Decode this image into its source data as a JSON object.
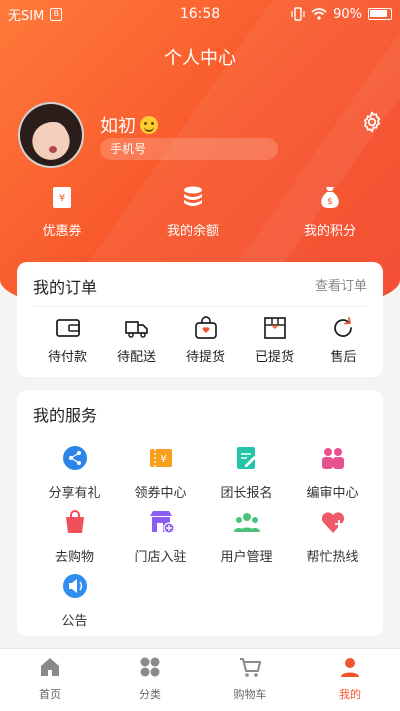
{
  "status_bar": {
    "carrier": "无SIM",
    "sim_icon_label": "B",
    "time": "16:58",
    "battery": "90%"
  },
  "header": {
    "title": "个人中心"
  },
  "profile": {
    "name": "如初",
    "phone_label": "手机号"
  },
  "hero_links": [
    {
      "label": "优惠券",
      "icon": "coupon-icon"
    },
    {
      "label": "我的余额",
      "icon": "coins-icon"
    },
    {
      "label": "我的积分",
      "icon": "money-bag-icon"
    }
  ],
  "orders": {
    "title": "我的订单",
    "view_all": "查看订单",
    "items": [
      {
        "label": "待付款",
        "icon": "wallet-icon"
      },
      {
        "label": "待配送",
        "icon": "delivery-truck-icon"
      },
      {
        "label": "待提货",
        "icon": "bag-icon"
      },
      {
        "label": "已提货",
        "icon": "box-icon"
      },
      {
        "label": "售后",
        "icon": "return-icon"
      }
    ]
  },
  "services": {
    "title": "我的服务",
    "items": [
      {
        "label": "分享有礼",
        "icon": "share-icon",
        "color": "#2b86e8"
      },
      {
        "label": "领券中心",
        "icon": "coupon-center-icon",
        "color": "#f6a01e"
      },
      {
        "label": "团长报名",
        "icon": "edit-form-icon",
        "color": "#23c4a8"
      },
      {
        "label": "编审中心",
        "icon": "users-icon",
        "color": "#e8518f"
      },
      {
        "label": "去购物",
        "icon": "shopping-bag-icon",
        "color": "#f0505a"
      },
      {
        "label": "门店入驻",
        "icon": "store-icon",
        "color": "#8b5cf6"
      },
      {
        "label": "用户管理",
        "icon": "group-icon",
        "color": "#4cc17a"
      },
      {
        "label": "帮忙热线",
        "icon": "heart-plus-icon",
        "color": "#f05a68"
      },
      {
        "label": "公告",
        "icon": "speaker-icon",
        "color": "#2f8ef0"
      }
    ]
  },
  "tabbar": {
    "items": [
      {
        "label": "首页",
        "icon": "home-icon"
      },
      {
        "label": "分类",
        "icon": "category-icon"
      },
      {
        "label": "购物车",
        "icon": "cart-icon"
      },
      {
        "label": "我的",
        "icon": "profile-icon",
        "active": true
      }
    ]
  },
  "colors": {
    "brand": "#f1552b",
    "accent": "#ff7a3a"
  }
}
